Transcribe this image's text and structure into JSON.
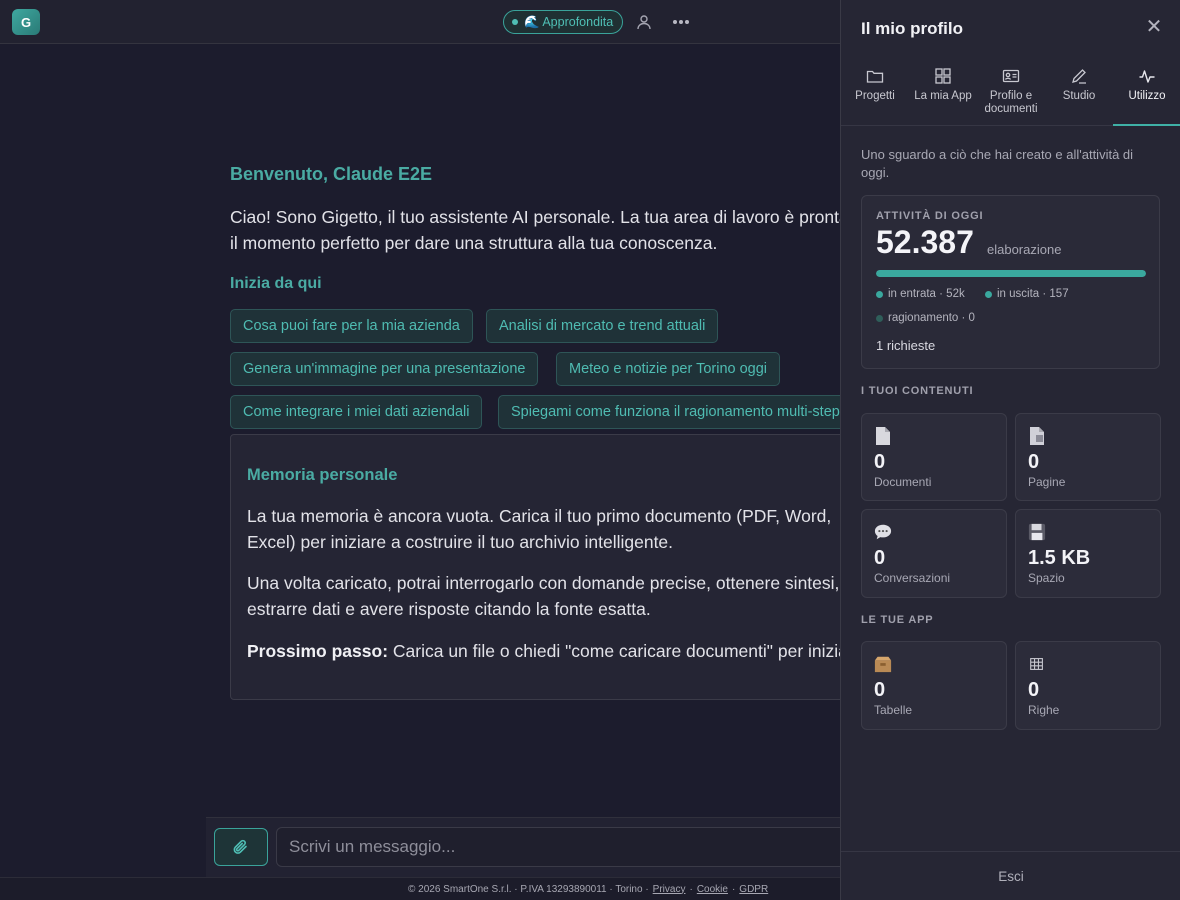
{
  "app": {
    "logo_letter": "G",
    "mode_label": "🌊 Approfondita"
  },
  "chat": {
    "welcome": "Benvenuto, Claude E2E",
    "intro": "Ciao! Sono Gigetto, il tuo assistente AI personale. La tua area di lavoro è pronta: è il momento perfetto per dare una struttura alla tua conoscenza.",
    "start_title": "Inizia da qui",
    "suggestions": [
      "Cosa puoi fare per la mia azienda",
      "Analisi di mercato e trend attuali",
      "Genera un'immagine per una presentazione",
      "Meteo e notizie per Torino oggi",
      "Come integrare i miei dati aziendali",
      "Spiegami come funziona il ragionamento multi-step"
    ],
    "memory": {
      "title": "Memoria personale",
      "p1": "La tua memoria è ancora vuota. Carica il tuo primo documento (PDF, Word, Excel) per iniziare a costruire il tuo archivio intelligente.",
      "p2": "Una volta caricato, potrai interrogarlo con domande precise, ottenere sintesi, estrarre dati e avere risposte citando la fonte esatta.",
      "p3_bold": "Prossimo passo:",
      "p3_rest": " Carica un file o chiedi \"come caricare documenti\" per iniziare."
    },
    "composer_placeholder": "Scrivi un messaggio..."
  },
  "footer": {
    "copyright": "© 2026 SmartOne S.r.l. · P.IVA 13293890011 · Torino ·",
    "privacy": "Privacy",
    "sep1": "·",
    "cookie": "Cookie",
    "sep2": "·",
    "gdpr": "GDPR"
  },
  "profile": {
    "title": "Il mio profilo",
    "close": "✕",
    "tabs": [
      {
        "label": "Progetti",
        "icon": "folder-icon"
      },
      {
        "label": "La mia App",
        "icon": "grid-icon"
      },
      {
        "label": "Profilo e documenti",
        "icon": "id-card-icon"
      },
      {
        "label": "Studio",
        "icon": "pencil-icon"
      },
      {
        "label": "Utilizzo",
        "icon": "activity-icon"
      }
    ],
    "subtitle": "Uno sguardo a ciò che hai creato e all'attività di oggi.",
    "activity": {
      "label": "ATTIVITÀ DI OGGI",
      "value": "52.387",
      "unit": "elaborazione",
      "bar_fraction": 1.0,
      "legend_in": "in entrata · 52k",
      "legend_out": "in uscita · 157",
      "legend_reason": "ragionamento · 0",
      "requests": "1 richieste",
      "colors": {
        "in": "#3aa89e",
        "out": "#3aa89e",
        "reason": "#2f5e5a"
      }
    },
    "contents_label": "I TUOI CONTENUTI",
    "contents": [
      {
        "value": "0",
        "label": "Documenti",
        "icon": "document-icon"
      },
      {
        "value": "0",
        "label": "Pagine",
        "icon": "page-icon"
      },
      {
        "value": "0",
        "label": "Conversazioni",
        "icon": "speech-bubble-icon"
      },
      {
        "value": "1.5 KB",
        "label": "Spazio",
        "icon": "floppy-disk-icon"
      }
    ],
    "apps_label": "LE TUE APP",
    "apps": [
      {
        "value": "0",
        "label": "Tabelle",
        "icon": "box-icon"
      },
      {
        "value": "0",
        "label": "Righe",
        "icon": "table-grid-icon"
      }
    ],
    "logout": "Esci"
  }
}
